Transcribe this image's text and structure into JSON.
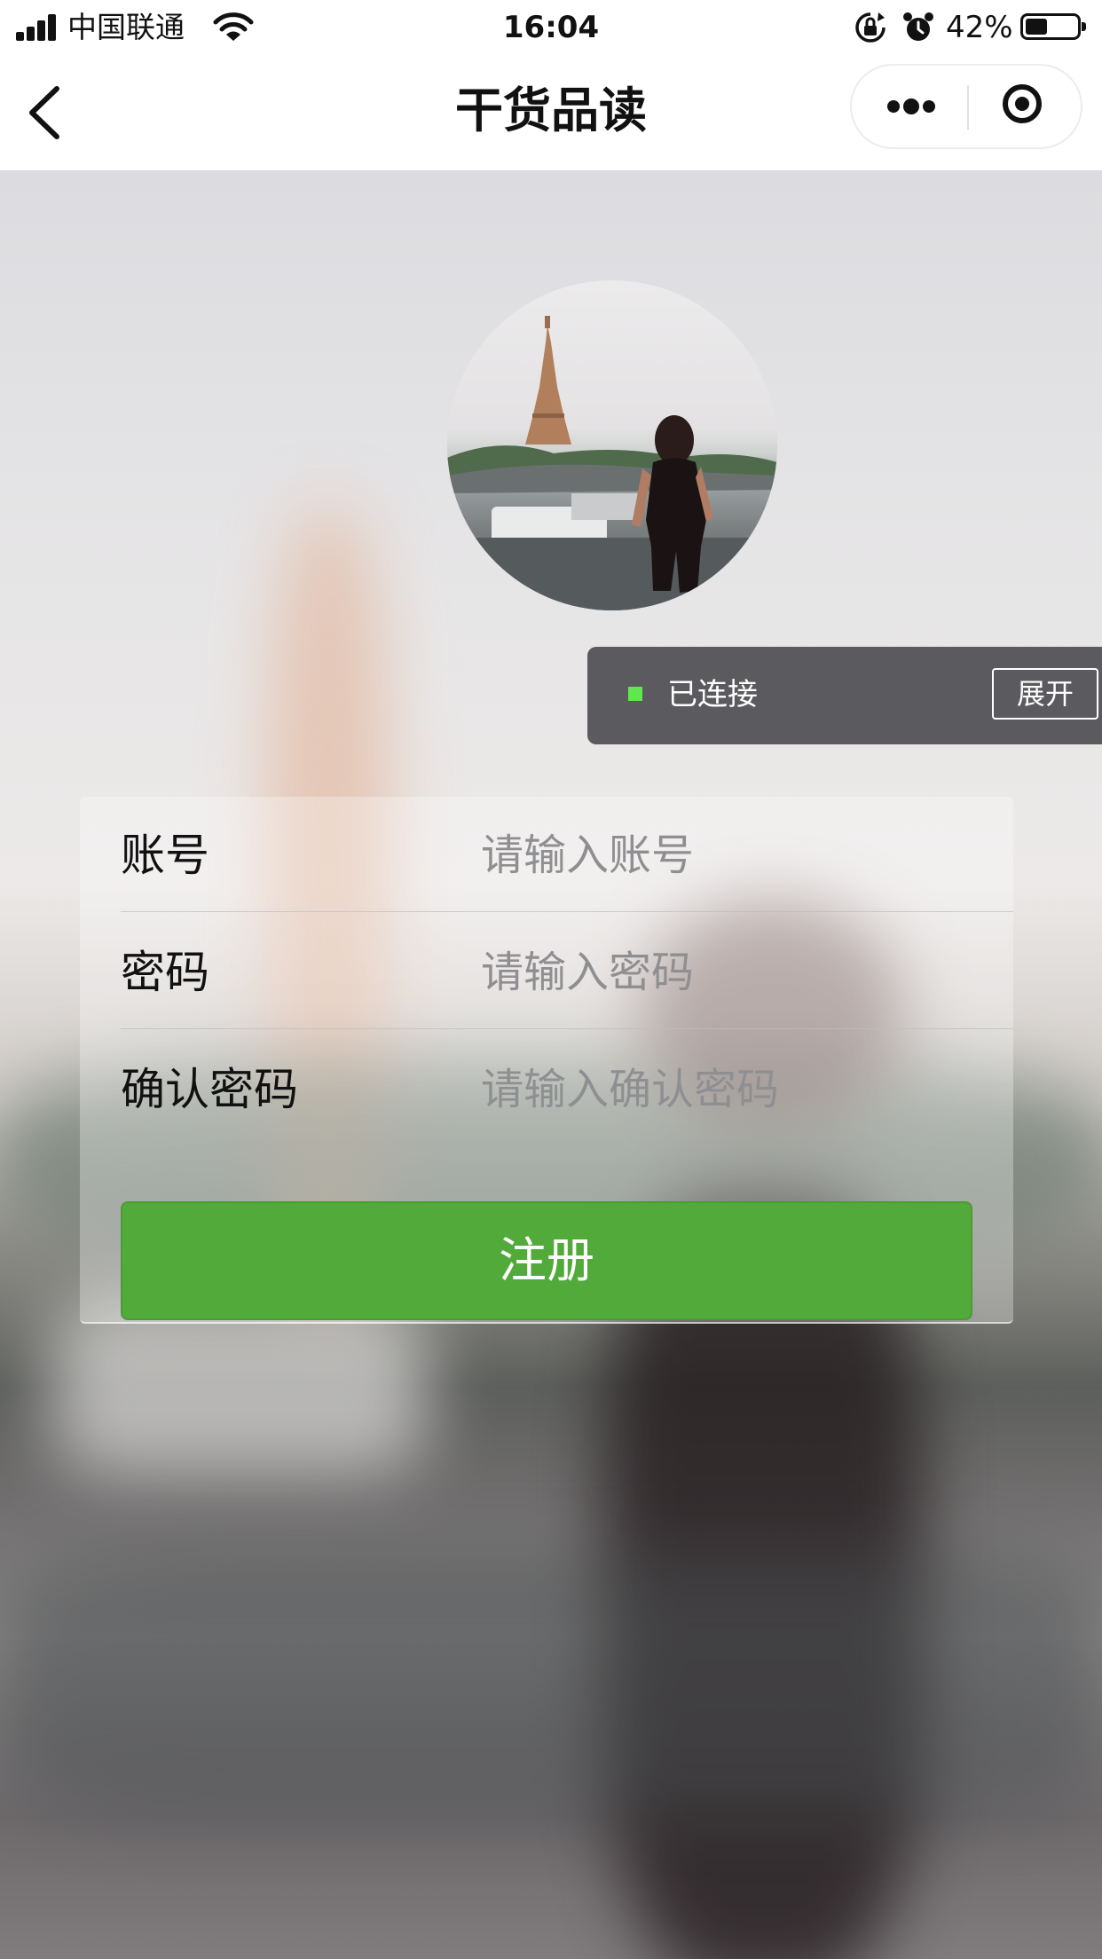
{
  "status_bar": {
    "carrier": "中国联通",
    "time": "16:04",
    "battery_percent": "42%",
    "battery_level": 0.42,
    "icons": [
      "signal-icon",
      "wifi-icon",
      "rotation-lock-icon",
      "alarm-icon",
      "battery-icon"
    ]
  },
  "nav": {
    "title": "干货品读",
    "icons": [
      "back-arrow-icon",
      "more-dots-icon",
      "close-target-icon"
    ]
  },
  "connection": {
    "status_text": "已连接",
    "status_color": "#61e650",
    "expand_label": "展开"
  },
  "form": {
    "fields": [
      {
        "label": "账号",
        "placeholder": "请输入账号",
        "value": ""
      },
      {
        "label": "密码",
        "placeholder": "请输入密码",
        "value": ""
      },
      {
        "label": "确认密码",
        "placeholder": "请输入确认密码",
        "value": ""
      }
    ],
    "submit_label": "注册",
    "submit_color": "#52aa3a"
  }
}
